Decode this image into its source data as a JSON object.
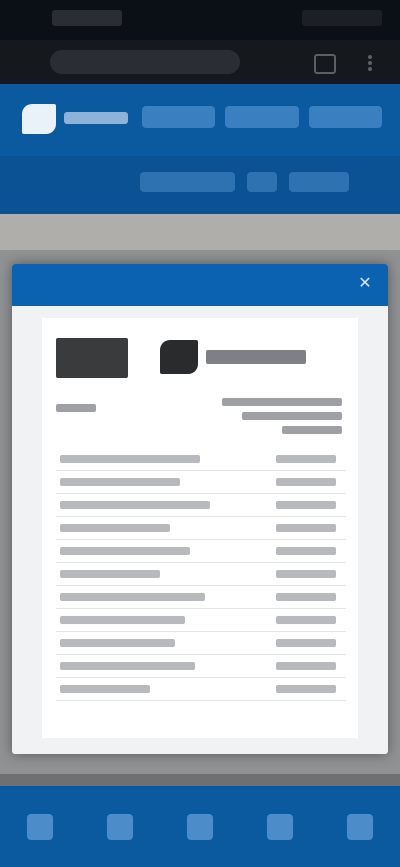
{
  "browser": {
    "url": "",
    "status_time": ""
  },
  "site": {
    "name": "",
    "nav": [
      "",
      "",
      "",
      ""
    ],
    "subnav": [
      "",
      "",
      ""
    ]
  },
  "modal": {
    "title": "",
    "close_glyph": "✕",
    "document": {
      "rows": 11
    }
  },
  "footer_nav": [
    "home-icon",
    "search-icon",
    "cart-icon",
    "account-icon",
    "menu-icon"
  ],
  "colors": {
    "brand_blue": "#0b5aa0",
    "modal_header": "#0b62b0",
    "overlay": "#8f9193"
  }
}
